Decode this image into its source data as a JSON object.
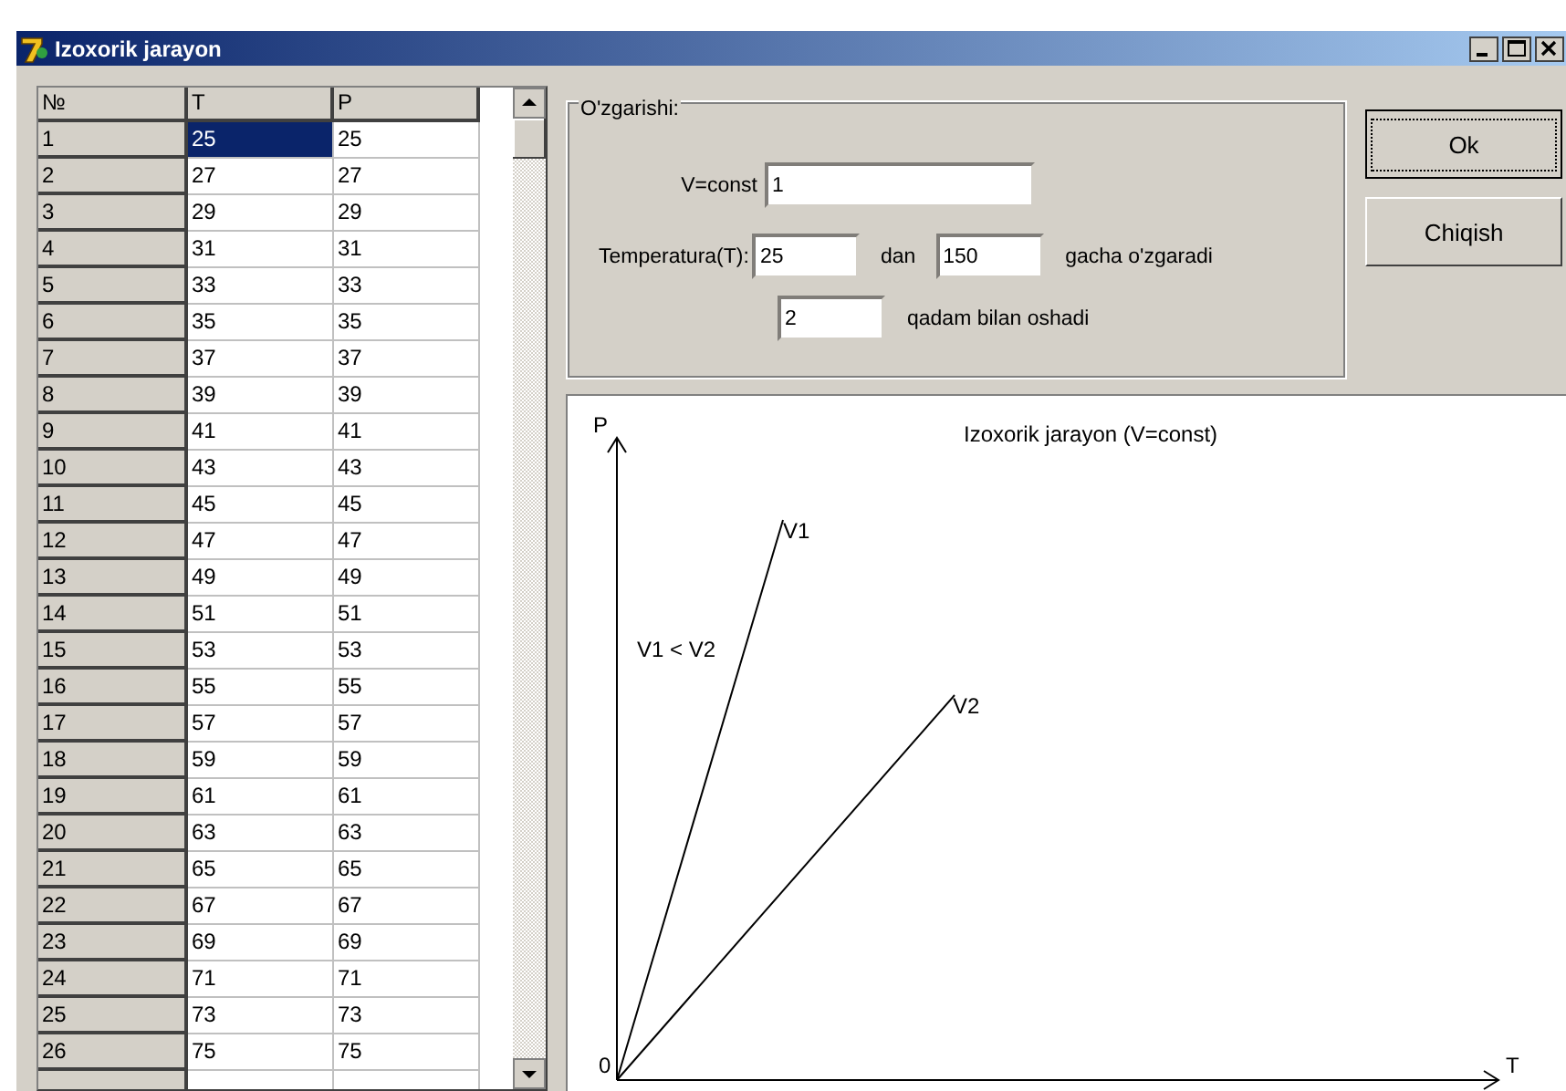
{
  "window": {
    "title": "Izoxorik jarayon"
  },
  "table": {
    "columns": [
      "№",
      "T",
      "P"
    ],
    "rows": [
      {
        "cells": [
          "1",
          "25",
          "25"
        ],
        "selected": true
      },
      {
        "cells": [
          "2",
          "27",
          "27"
        ],
        "selected": false
      },
      {
        "cells": [
          "3",
          "29",
          "29"
        ],
        "selected": false
      },
      {
        "cells": [
          "4",
          "31",
          "31"
        ],
        "selected": false
      },
      {
        "cells": [
          "5",
          "33",
          "33"
        ],
        "selected": false
      },
      {
        "cells": [
          "6",
          "35",
          "35"
        ],
        "selected": false
      },
      {
        "cells": [
          "7",
          "37",
          "37"
        ],
        "selected": false
      },
      {
        "cells": [
          "8",
          "39",
          "39"
        ],
        "selected": false
      },
      {
        "cells": [
          "9",
          "41",
          "41"
        ],
        "selected": false
      },
      {
        "cells": [
          "10",
          "43",
          "43"
        ],
        "selected": false
      },
      {
        "cells": [
          "11",
          "45",
          "45"
        ],
        "selected": false
      },
      {
        "cells": [
          "12",
          "47",
          "47"
        ],
        "selected": false
      },
      {
        "cells": [
          "13",
          "49",
          "49"
        ],
        "selected": false
      },
      {
        "cells": [
          "14",
          "51",
          "51"
        ],
        "selected": false
      },
      {
        "cells": [
          "15",
          "53",
          "53"
        ],
        "selected": false
      },
      {
        "cells": [
          "16",
          "55",
          "55"
        ],
        "selected": false
      },
      {
        "cells": [
          "17",
          "57",
          "57"
        ],
        "selected": false
      },
      {
        "cells": [
          "18",
          "59",
          "59"
        ],
        "selected": false
      },
      {
        "cells": [
          "19",
          "61",
          "61"
        ],
        "selected": false
      },
      {
        "cells": [
          "20",
          "63",
          "63"
        ],
        "selected": false
      },
      {
        "cells": [
          "21",
          "65",
          "65"
        ],
        "selected": false
      },
      {
        "cells": [
          "22",
          "67",
          "67"
        ],
        "selected": false
      },
      {
        "cells": [
          "23",
          "69",
          "69"
        ],
        "selected": false
      },
      {
        "cells": [
          "24",
          "71",
          "71"
        ],
        "selected": false
      },
      {
        "cells": [
          "25",
          "73",
          "73"
        ],
        "selected": false
      },
      {
        "cells": [
          "26",
          "75",
          "75"
        ],
        "selected": false
      }
    ]
  },
  "group": {
    "title": "O'zgarishi:",
    "volume_label": "V=const",
    "volume_value": "1",
    "temp_label": "Temperatura(T):",
    "from_value": "25",
    "from_label": "dan",
    "to_value": "150",
    "to_label": "gacha o'zgaradi",
    "step_value": "2",
    "step_label": "qadam bilan oshadi"
  },
  "buttons": [
    {
      "label": "Ok",
      "default": true
    },
    {
      "label": "Chiqish",
      "default": false
    }
  ],
  "graph": {
    "title": "Izoxorik jarayon (V=const)",
    "y_label": "P",
    "x_label": "T",
    "origin_label": "0",
    "line_labels": [
      "V1",
      "V2"
    ],
    "comparison": "V1 < V2"
  }
}
